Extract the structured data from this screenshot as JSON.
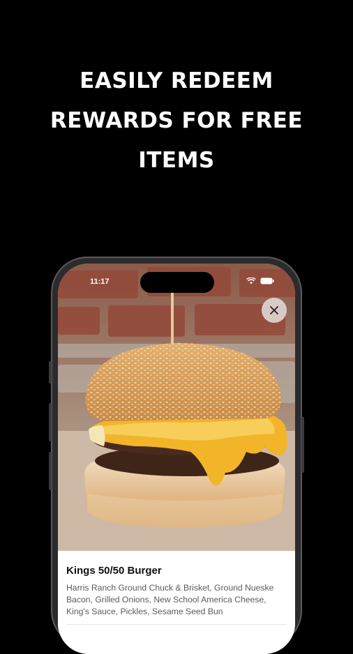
{
  "headline": {
    "line1": "EASILY REDEEM",
    "line2": "REWARDS FOR FREE",
    "line3": "ITEMS"
  },
  "status_bar": {
    "time": "11:17",
    "icons": [
      "signal-icon",
      "wifi-icon",
      "battery-icon"
    ]
  },
  "item": {
    "name": "Kings 50/50 Burger",
    "description": "Harris Ranch Ground Chuck & Brisket, Ground Nueske Bacon, Grilled Onions, New School America Cheese, King's Sauce, Pickles, Sesame Seed Bun"
  },
  "close_icon": "close-icon",
  "colors": {
    "background": "#000000",
    "headline": "#ffffff",
    "cheese": "#f2b52a",
    "bun": "#d9a560"
  }
}
